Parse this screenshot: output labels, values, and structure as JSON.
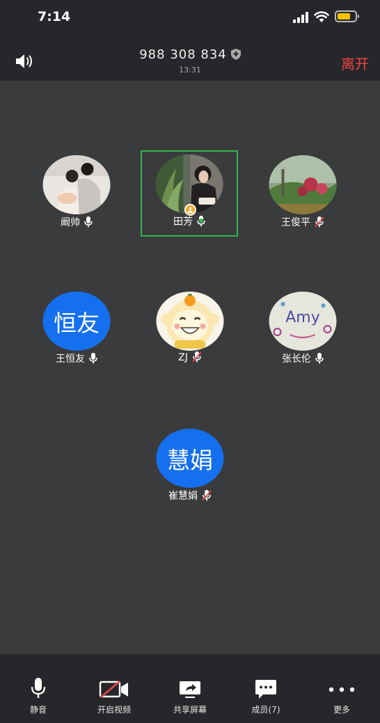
{
  "status_bar": {
    "time": "7:14"
  },
  "header": {
    "meeting_id": "988 308 834",
    "duration": "13:31",
    "leave_label": "离开"
  },
  "participants": [
    {
      "name": "阚帅",
      "avatar_text": "",
      "mic": "on",
      "active": false
    },
    {
      "name": "田芳",
      "avatar_text": "",
      "mic": "speaking",
      "active": true,
      "host": true
    },
    {
      "name": "王俊平",
      "avatar_text": "",
      "mic": "muted",
      "active": false
    },
    {
      "name": "王恒友",
      "avatar_text": "恒友",
      "mic": "on",
      "active": false
    },
    {
      "name": "ZJ",
      "avatar_text": "",
      "mic": "muted",
      "active": false
    },
    {
      "name": "张长伦",
      "avatar_text": "",
      "mic": "on",
      "active": false
    },
    {
      "name": "崔慧娟",
      "avatar_text": "慧娟",
      "mic": "muted",
      "active": false
    }
  ],
  "avatar_photo_text": "Amy",
  "toolbar": {
    "mute": "静音",
    "video": "开启视频",
    "share": "共享屏幕",
    "members": "成员(7)",
    "more": "更多"
  },
  "colors": {
    "accent_blue": "#1570ef",
    "active_green": "#2fb74c",
    "leave_red": "#ee4545",
    "battery_yellow": "#f4c400"
  }
}
